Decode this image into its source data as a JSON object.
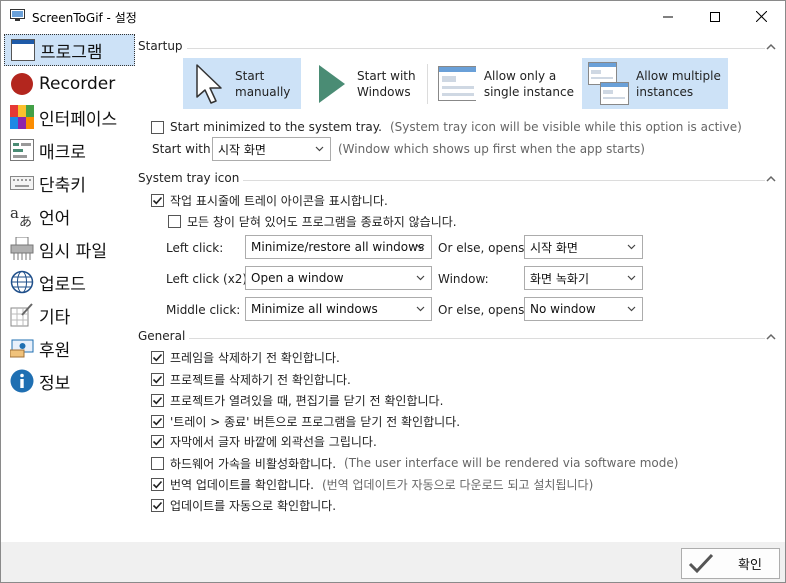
{
  "window": {
    "title": "ScreenToGif - 설정"
  },
  "sidebar": {
    "items": [
      {
        "label": "프로그램",
        "icon": "window-icon"
      },
      {
        "label": "Recorder",
        "icon": "record-icon"
      },
      {
        "label": "인터페이스",
        "icon": "palette-icon"
      },
      {
        "label": "매크로",
        "icon": "macro-icon"
      },
      {
        "label": "단축키",
        "icon": "keyboard-icon"
      },
      {
        "label": "언어",
        "icon": "language-icon"
      },
      {
        "label": "임시 파일",
        "icon": "temp-files-icon"
      },
      {
        "label": "업로드",
        "icon": "globe-icon"
      },
      {
        "label": "기타",
        "icon": "extras-icon"
      },
      {
        "label": "후원",
        "icon": "donate-icon"
      },
      {
        "label": "정보",
        "icon": "info-icon"
      }
    ]
  },
  "startup": {
    "title": "Startup",
    "tiles": [
      {
        "label": "Start\nmanually",
        "selected": true
      },
      {
        "label": "Start with\nWindows",
        "selected": false
      },
      {
        "label": "Allow only a\nsingle instance",
        "selected": false
      },
      {
        "label": "Allow multiple\ninstances",
        "selected": true
      }
    ],
    "minimized_label": "Start minimized to the system tray.",
    "minimized_hint": "(System tray icon will be visible while this option is active)",
    "minimized_checked": false,
    "start_with_label": "Start with:",
    "start_with_value": "시작 화면",
    "start_with_hint": "(Window which shows up first when the app starts)"
  },
  "tray": {
    "title": "System tray icon",
    "show_icon_label": "작업 표시줄에 트레이 아이콘을 표시합니다.",
    "show_icon_checked": true,
    "keep_open_label": "모든 창이 닫혀 있어도 프로그램을 종료하지 않습니다.",
    "keep_open_checked": false,
    "left_click_label": "Left click:",
    "left_click_value": "Minimize/restore all windows",
    "left_click_else_label": "Or else, opens:",
    "left_click_else_value": "시작 화면",
    "left_click2_label": "Left click (x2):",
    "left_click2_value": "Open a window",
    "window_label": "Window:",
    "window_value": "화면 녹화기",
    "middle_click_label": "Middle click:",
    "middle_click_value": "Minimize all windows",
    "middle_else_label": "Or else, opens:",
    "middle_else_value": "No window"
  },
  "general": {
    "title": "General",
    "options": [
      {
        "label": "프레임을 삭제하기 전 확인합니다.",
        "checked": true,
        "hint": ""
      },
      {
        "label": "프로젝트를 삭제하기 전 확인합니다.",
        "checked": true,
        "hint": ""
      },
      {
        "label": "프로젝트가 열려있을 때, 편집기를 닫기 전 확인합니다.",
        "checked": true,
        "hint": ""
      },
      {
        "label": "'트레이 > 종료' 버튼으로 프로그램을 닫기 전 확인합니다.",
        "checked": true,
        "hint": ""
      },
      {
        "label": "자막에서 글자 바깥에 외곽선을 그립니다.",
        "checked": true,
        "hint": ""
      },
      {
        "label": "하드웨어 가속을 비활성화합니다.",
        "checked": false,
        "hint": "(The user interface will be rendered via software mode)"
      },
      {
        "label": "번역 업데이트를 확인합니다.",
        "checked": true,
        "hint": "(번역 업데이트가 자동으로 다운로드 되고 설치됩니다)"
      },
      {
        "label": "업데이트를 자동으로 확인합니다.",
        "checked": true,
        "hint": ""
      }
    ]
  },
  "footer": {
    "ok_label": "확인"
  },
  "colors": {
    "selected_bg": "#cde2f7",
    "accent_green": "#4a8c74",
    "record_red": "#b3261e",
    "info_blue": "#1f6fb2"
  }
}
